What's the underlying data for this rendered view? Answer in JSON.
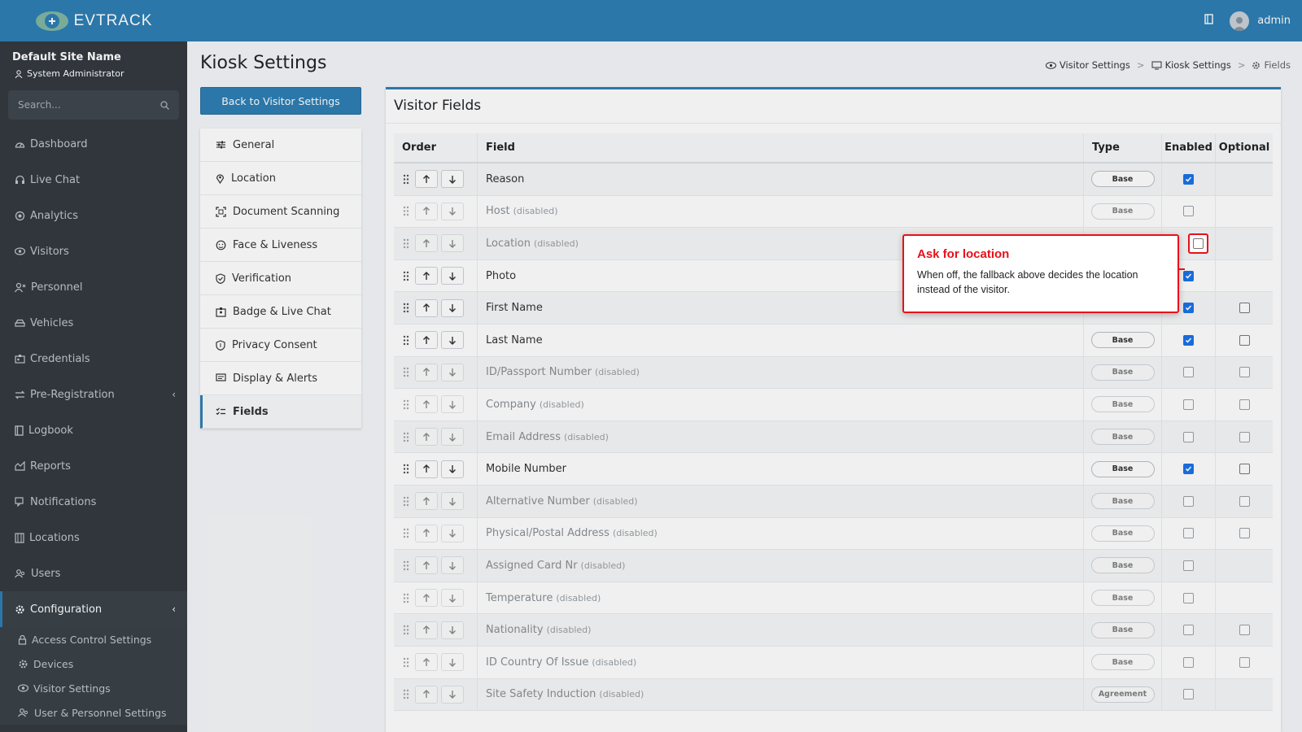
{
  "app": {
    "brand": "EVTRACK",
    "user": "admin"
  },
  "sidebar": {
    "site_name": "Default Site Name",
    "role": "System Administrator",
    "search_placeholder": "Search...",
    "items": [
      {
        "label": "Dashboard",
        "icon": "dashboard-icon"
      },
      {
        "label": "Live Chat",
        "icon": "headset-icon"
      },
      {
        "label": "Analytics",
        "icon": "target-icon"
      },
      {
        "label": "Visitors",
        "icon": "eye-icon"
      },
      {
        "label": "Personnel",
        "icon": "personnel-icon"
      },
      {
        "label": "Vehicles",
        "icon": "car-icon"
      },
      {
        "label": "Credentials",
        "icon": "id-card-icon"
      },
      {
        "label": "Pre-Registration",
        "icon": "exchange-icon",
        "chevron": "‹"
      },
      {
        "label": "Logbook",
        "icon": "book-icon"
      },
      {
        "label": "Reports",
        "icon": "chart-icon"
      },
      {
        "label": "Notifications",
        "icon": "chat-icon"
      },
      {
        "label": "Locations",
        "icon": "building-icon"
      },
      {
        "label": "Users",
        "icon": "users-icon"
      },
      {
        "label": "Configuration",
        "icon": "gear-icon",
        "chevron": "‹",
        "active": true
      }
    ],
    "subitems": [
      {
        "label": "Access Control Settings",
        "icon": "lock-icon"
      },
      {
        "label": "Devices",
        "icon": "gear-icon"
      },
      {
        "label": "Visitor Settings",
        "icon": "eye-icon"
      },
      {
        "label": "User & Personnel Settings",
        "icon": "users-icon"
      }
    ]
  },
  "page": {
    "title": "Kiosk Settings",
    "breadcrumb": [
      "Visitor Settings",
      "Kiosk Settings",
      "Fields"
    ],
    "back_button": "Back to Visitor Settings"
  },
  "settings_menu": [
    {
      "label": "General",
      "icon": "sliders-icon"
    },
    {
      "label": "Location",
      "icon": "map-pin-icon"
    },
    {
      "label": "Document Scanning",
      "icon": "scan-icon"
    },
    {
      "label": "Face & Liveness",
      "icon": "face-icon"
    },
    {
      "label": "Verification",
      "icon": "shield-check-icon"
    },
    {
      "label": "Badge & Live Chat",
      "icon": "badge-icon"
    },
    {
      "label": "Privacy Consent",
      "icon": "shield-icon"
    },
    {
      "label": "Display & Alerts",
      "icon": "display-icon"
    },
    {
      "label": "Fields",
      "icon": "checklist-icon",
      "active": true
    }
  ],
  "card": {
    "title": "Visitor Fields",
    "columns": {
      "order": "Order",
      "field": "Field",
      "type": "Type",
      "enabled": "Enabled",
      "optional": "Optional"
    },
    "disabled_suffix": "(disabled)",
    "rows": [
      {
        "field": "Reason",
        "type": "Base",
        "enabled": true,
        "optional": null,
        "disabled": false
      },
      {
        "field": "Host",
        "type": "Base",
        "enabled": false,
        "optional": null,
        "disabled": true
      },
      {
        "field": "Location",
        "type": "",
        "enabled": false,
        "optional": null,
        "disabled": true
      },
      {
        "field": "Photo",
        "type": "",
        "enabled": true,
        "optional": null,
        "disabled": false
      },
      {
        "field": "First Name",
        "type": "",
        "enabled": true,
        "optional": false,
        "disabled": false
      },
      {
        "field": "Last Name",
        "type": "Base",
        "enabled": true,
        "optional": false,
        "disabled": false
      },
      {
        "field": "ID/Passport Number",
        "type": "Base",
        "enabled": false,
        "optional": false,
        "disabled": true
      },
      {
        "field": "Company",
        "type": "Base",
        "enabled": false,
        "optional": false,
        "disabled": true
      },
      {
        "field": "Email Address",
        "type": "Base",
        "enabled": false,
        "optional": false,
        "disabled": true
      },
      {
        "field": "Mobile Number",
        "type": "Base",
        "enabled": true,
        "optional": false,
        "disabled": false
      },
      {
        "field": "Alternative Number",
        "type": "Base",
        "enabled": false,
        "optional": false,
        "disabled": true
      },
      {
        "field": "Physical/Postal Address",
        "type": "Base",
        "enabled": false,
        "optional": false,
        "disabled": true
      },
      {
        "field": "Assigned Card Nr",
        "type": "Base",
        "enabled": false,
        "optional": null,
        "disabled": true
      },
      {
        "field": "Temperature",
        "type": "Base",
        "enabled": false,
        "optional": null,
        "disabled": true
      },
      {
        "field": "Nationality",
        "type": "Base",
        "enabled": false,
        "optional": false,
        "disabled": true
      },
      {
        "field": "ID Country Of Issue",
        "type": "Base",
        "enabled": false,
        "optional": false,
        "disabled": true
      },
      {
        "field": "Site Safety Induction",
        "type": "Agreement",
        "enabled": false,
        "optional": null,
        "disabled": true
      }
    ]
  },
  "callout": {
    "title": "Ask for location",
    "body": "When off, the fallback above decides the location instead of the visitor."
  },
  "colors": {
    "primary": "#2e7fb4",
    "sidebar": "#343a40",
    "accent_red": "#e8101a",
    "check": "#1a73e8"
  }
}
